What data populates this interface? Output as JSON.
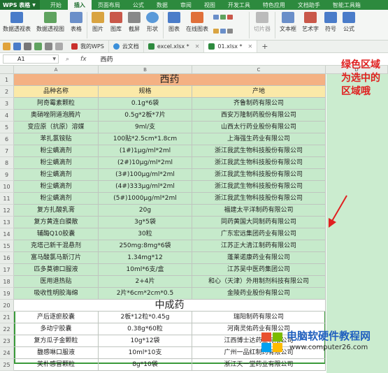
{
  "app": {
    "name": "WPS 表格"
  },
  "menu": [
    "开始",
    "插入",
    "页面布局",
    "公式",
    "数据",
    "审阅",
    "视图",
    "开发工具",
    "特色应用",
    "文档助手",
    "智能工具箱"
  ],
  "menu_active": "插入",
  "ribbon": {
    "buttons": [
      "数据透视表",
      "数据透视图",
      "表格",
      "图片",
      "图库",
      "截屏",
      "形状",
      "图表",
      "在线图表",
      "切片器",
      "文本框",
      "艺术字",
      "符号",
      "公式"
    ]
  },
  "tabs": [
    "我的WPS",
    "云文档",
    "excel.xlsx *",
    "01.xlsx *"
  ],
  "formula_bar": {
    "cell_ref": "A1",
    "fx": "fx",
    "value": "西药"
  },
  "columns": [
    "A",
    "B",
    "C",
    "D"
  ],
  "rows": [
    {
      "num": "1",
      "a": "西药",
      "type": "title"
    },
    {
      "num": "2",
      "a": "品种名称",
      "b": "规格",
      "c": "产地",
      "type": "header"
    },
    {
      "num": "3",
      "a": "阿奇霉素颗粒",
      "b": "0.1g*6袋",
      "c": "齐鲁制药有限公司"
    },
    {
      "num": "4",
      "a": "奥硝唑阴道泡腾片",
      "b": "0.5g*2板*7片",
      "c": "西安万隆制药股份有限公司"
    },
    {
      "num": "5",
      "a": "变应原（抗原）溶媒",
      "b": "9ml/支",
      "c": "山西太行药业股份有限公司"
    },
    {
      "num": "6",
      "a": "苯扎氯铵贴",
      "b": "100贴*2.5cm*1.8cm",
      "c": "上海强生药业有限公司"
    },
    {
      "num": "7",
      "a": "粉尘螨滴剂",
      "b": "(1#)1μg/ml*2ml",
      "c": "浙江我武生物科技股份有限公司"
    },
    {
      "num": "8",
      "a": "粉尘螨滴剂",
      "b": "(2#)10μg/ml*2ml",
      "c": "浙江我武生物科技股份有限公司"
    },
    {
      "num": "9",
      "a": "粉尘螨滴剂",
      "b": "(3#)100μg/ml*2ml",
      "c": "浙江我武生物科技股份有限公司"
    },
    {
      "num": "10",
      "a": "粉尘螨滴剂",
      "b": "(4#)333μg/ml*2ml",
      "c": "浙江我武生物科技股份有限公司"
    },
    {
      "num": "11",
      "a": "粉尘螨滴剂",
      "b": "(5#)1000μg/ml*2ml",
      "c": "浙江我武生物科技股份有限公司"
    },
    {
      "num": "12",
      "a": "复方扎酸乳膏",
      "b": "20g",
      "c": "福建太平洋制药有限公司"
    },
    {
      "num": "13",
      "a": "复方黄连白膜散",
      "b": "3g*5袋",
      "c": "同药黄国大同制药有限公司"
    },
    {
      "num": "14",
      "a": "辅酶Q10胶囊",
      "b": "30粒",
      "c": "广东宏远集团药业有限公司"
    },
    {
      "num": "15",
      "a": "克塔己新干混悬剂",
      "b": "250mg:8mg*6袋",
      "c": "江苏正大清江制药有限公司"
    },
    {
      "num": "16",
      "a": "富马酸氯马斯汀片",
      "b": "1.34mg*12",
      "c": "蓬莱诺康药业有限公司"
    },
    {
      "num": "17",
      "a": "匹多莫德口服液",
      "b": "10ml*6支/盒",
      "c": "江苏吴中医药集团公司"
    },
    {
      "num": "18",
      "a": "医用退热贴",
      "b": "2+4片",
      "c": "和心（天津）外用制剂科技有限公司"
    },
    {
      "num": "19",
      "a": "吸收性明胶海绵",
      "b": "2片*6cm*2cm*0.5",
      "c": "金陵药业股份有限公司"
    },
    {
      "num": "20",
      "a": "中成药",
      "type": "title2"
    },
    {
      "num": "21",
      "a": "产后逐瘀胶囊",
      "b": "2板*12粒*0.45g",
      "c": "瑞阳制药有限公司"
    },
    {
      "num": "22",
      "a": "多动宁胶囊",
      "b": "0.38g*60粒",
      "c": "河南灵佑药业有限公司"
    },
    {
      "num": "23",
      "a": "复方瓜子金颗粒",
      "b": "10g*12袋",
      "c": "江西博士达药业有限公司"
    },
    {
      "num": "24",
      "a": "馥感啉口服液",
      "b": "10ml*10支",
      "c": "广州一品红制药有限公司"
    },
    {
      "num": "25",
      "a": "芙朴感冒颗粒",
      "b": "8g*10袋",
      "c": "浙江天一堂药业有限公司"
    }
  ],
  "annotation": "绿色区域为选中的区域哦",
  "watermark": {
    "title": "电脑软硬件教程网",
    "url": "www.computer26.com"
  },
  "colors": {
    "accent": "#2d8a3e",
    "selection": "#c6eacb",
    "title_fill": "#f4b183",
    "header_fill": "#fbe9a8",
    "annotation": "#e02020",
    "watermark": "#1f5fbf"
  }
}
